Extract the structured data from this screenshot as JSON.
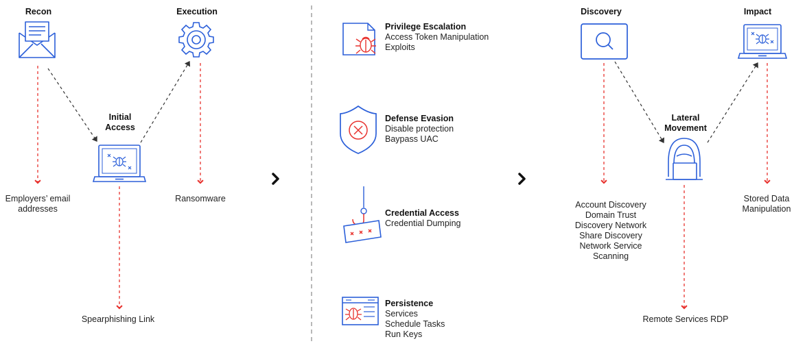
{
  "colors": {
    "blue": "#2b5fd9",
    "red": "#e8322e",
    "dark": "#333333",
    "divider": "#888888"
  },
  "recon": {
    "title": "Recon",
    "note_line1": "Employers’ email",
    "note_line2": "addresses",
    "icon": "envelope-icon"
  },
  "execution": {
    "title": "Execution",
    "note": "Ransomware",
    "icon": "gear-icon"
  },
  "initial_access": {
    "title_line1": "Initial",
    "title_line2": "Access",
    "note": "Spearphishing Link",
    "icon": "laptop-bug-icon"
  },
  "tactics": [
    {
      "title": "Privilege Escalation",
      "items": [
        "Access Token Manipulation",
        "Exploits"
      ],
      "icon": "document-bug-icon"
    },
    {
      "title": "Defense Evasion",
      "items": [
        "Disable protection",
        "Baypass UAC"
      ],
      "icon": "shield-x-icon"
    },
    {
      "title": "Credential Access",
      "items": [
        "Credential Dumping"
      ],
      "icon": "password-phishing-icon"
    },
    {
      "title": "Persistence",
      "items": [
        "Services",
        "Schedule Tasks",
        "Run Keys"
      ],
      "icon": "window-bug-icon"
    }
  ],
  "discovery": {
    "title": "Discovery",
    "items": [
      "Account Discovery",
      "Domain Trust",
      "Discovery Network",
      "Share Discovery",
      "Network Service",
      "Scanning"
    ],
    "icon": "search-monitor-icon"
  },
  "impact": {
    "title": "Impact",
    "note_line1": "Stored Data",
    "note_line2": "Manipulation",
    "icon": "laptop-bug-icon"
  },
  "lateral_movement": {
    "title_line1": "Lateral",
    "title_line2": "Movement",
    "note": "Remote Services RDP",
    "icon": "hacker-icon"
  },
  "arrows": [
    "chevron-right-icon",
    "chevron-right-icon"
  ]
}
